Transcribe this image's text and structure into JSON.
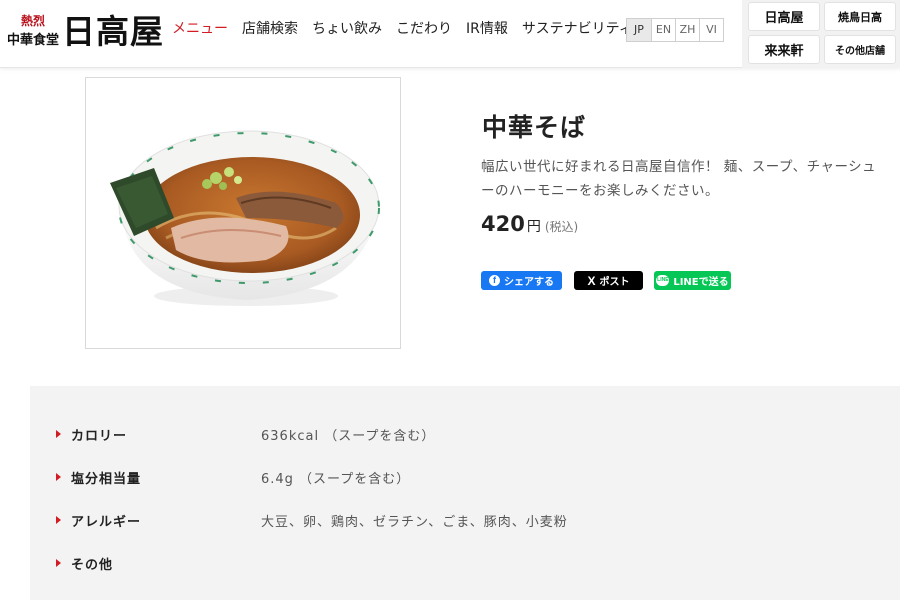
{
  "header": {
    "logo": {
      "small_line1": "熱烈",
      "small_line2": "中華食堂",
      "main": "日高屋"
    },
    "nav": [
      {
        "label": "メニュー",
        "active": true
      },
      {
        "label": "店舗検索"
      },
      {
        "label": "ちょい飲み"
      },
      {
        "label": "こだわり"
      },
      {
        "label": "IR情報"
      },
      {
        "label": "サステナビリティ"
      }
    ],
    "languages": [
      "JP",
      "EN",
      "ZH",
      "VI"
    ],
    "brands": [
      "日高屋",
      "焼鳥日高",
      "来来軒",
      "その他店舗"
    ]
  },
  "product": {
    "image_alt": "中華そば",
    "title": "中華そば",
    "description": "幅広い世代に好まれる日高屋自信作！ 麺、スープ、チャーシューのハーモニーをお楽しみください。",
    "price": "420",
    "price_unit": "円",
    "tax_note": "(税込)"
  },
  "share": {
    "facebook": "シェアする",
    "x_icon": "X",
    "x": "ポスト",
    "line_icon": "LINE",
    "line": "LINEで送る"
  },
  "nutrition": [
    {
      "label": "カロリー",
      "value": "636kcal （スープを含む）"
    },
    {
      "label": "塩分相当量",
      "value": "6.4g （スープを含む）"
    },
    {
      "label": "アレルギー",
      "value": "大豆、卵、鶏肉、ゼラチン、ごま、豚肉、小麦粉"
    },
    {
      "label": "その他",
      "value": ""
    }
  ],
  "colors": {
    "accent": "#d11c24",
    "facebook": "#1877f2",
    "x": "#000000",
    "line": "#06c755",
    "panel": "#f3f3f3"
  },
  "icons": [
    "facebook-icon",
    "x-icon",
    "line-icon",
    "bullet-triangle-icon"
  ]
}
